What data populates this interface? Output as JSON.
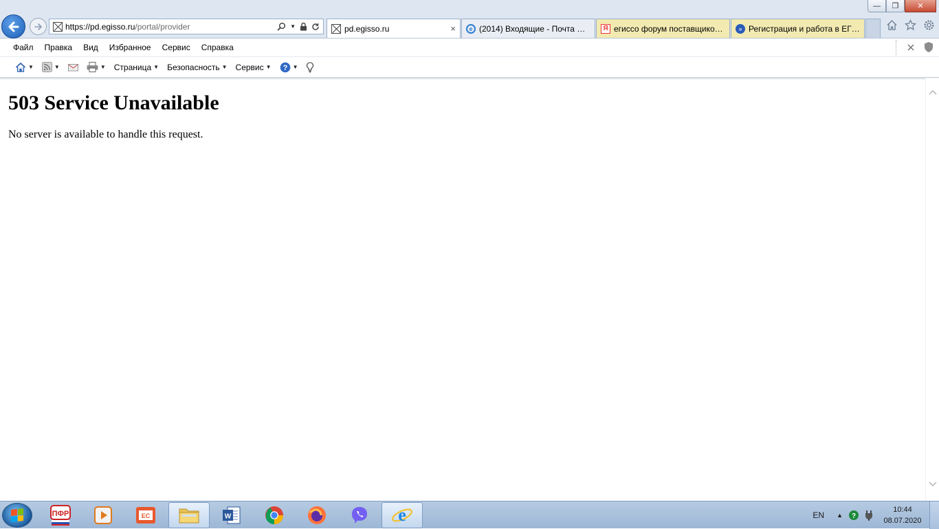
{
  "browser": {
    "address": {
      "url_prefix": "https://pd.",
      "url_domain": "egisso.ru",
      "url_path": "/portal/provider"
    },
    "tabs": [
      {
        "label": "pd.egisso.ru",
        "close": "×",
        "active": true
      },
      {
        "label": "(2014) Входящие - Почта Mai...",
        "active": false
      },
      {
        "label": "егиссо форум поставщиков ...",
        "active": false
      },
      {
        "label": "Регистрация и работа в ЕГИ...",
        "active": false
      }
    ],
    "window_controls": {
      "minimize": "—",
      "maximize": "❐",
      "close": "✕"
    }
  },
  "menubar": {
    "items": [
      "Файл",
      "Правка",
      "Вид",
      "Избранное",
      "Сервис",
      "Справка"
    ]
  },
  "cmdbar": {
    "page_label": "Страница",
    "security_label": "Безопасность",
    "tools_label": "Сервис"
  },
  "page": {
    "heading": "503 Service Unavailable",
    "message": "No server is available to handle this request."
  },
  "taskbar": {
    "lang": "EN",
    "time": "10:44",
    "date": "08.07.2020"
  }
}
